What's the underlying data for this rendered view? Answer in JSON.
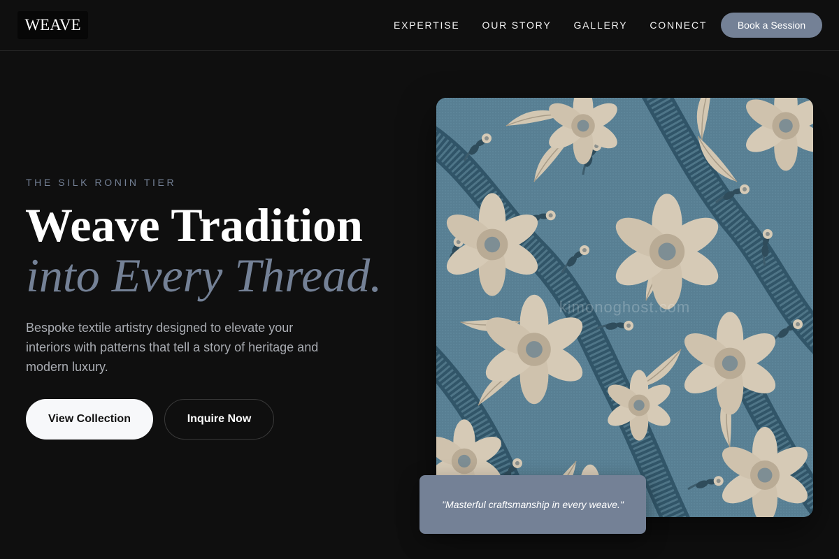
{
  "nav": {
    "logo": "WEAVE",
    "links": [
      "EXPERTISE",
      "OUR STORY",
      "GALLERY",
      "CONNECT"
    ],
    "cta": "Book a Session"
  },
  "hero": {
    "eyebrow": "THE SILK RONIN TIER",
    "headline_line1": "Weave Tradition",
    "headline_line2": "into Every Thread.",
    "description": "Bespoke textile artistry designed to elevate your interiors with patterns that tell a story of heritage and modern luxury.",
    "primary_button": "View Collection",
    "secondary_button": "Inquire Now"
  },
  "image": {
    "watermark": "kimonoghost.com"
  },
  "quote": {
    "text": "\"Masterful craftsmanship in every weave.\""
  },
  "colors": {
    "background": "#0f0f0f",
    "accent": "#748196",
    "fabric_blue": "#577e92",
    "fabric_cream": "#d9cdb8"
  }
}
